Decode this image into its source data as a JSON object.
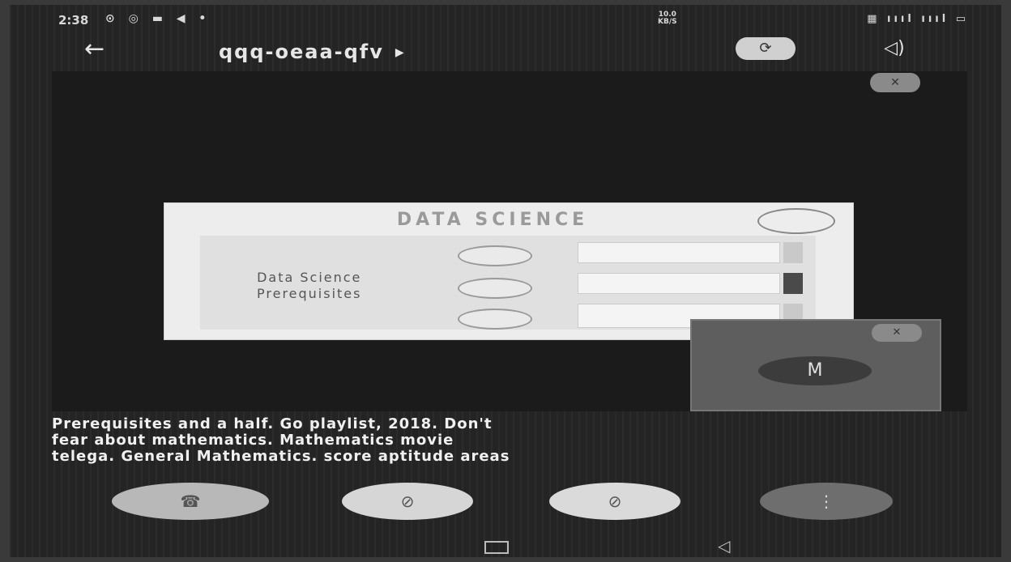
{
  "status_bar": {
    "time": "2:38",
    "net_speed": "10.0\nKB/S"
  },
  "call_bar": {
    "meeting_code": "qqq-oeaa-qfv",
    "back_icon": "arrow-left-icon",
    "switch_camera_icon": "camera-switch-icon",
    "speaker_icon": "speaker-icon"
  },
  "presentation": {
    "slide_title": "DATA SCIENCE",
    "slide_subtitle": "Data Science\nPrerequisites"
  },
  "self_view": {
    "avatar_initial": "M"
  },
  "captions": {
    "line1": "Prerequisites and a half. Go playlist, 2018.  Don't",
    "line2": "fear about mathematics. Mathematics movie",
    "line3": "telega. General Mathematics. score aptitude areas"
  },
  "controls": {
    "end_call_icon": "phone-hangup-icon",
    "video_icon": "video-off-icon",
    "mic_icon": "mic-off-icon",
    "more_icon": "more-vertical-icon"
  },
  "colors": {
    "background": "#242424",
    "control_light": "#d6d6d6",
    "control_dark": "#6e6e6e"
  }
}
